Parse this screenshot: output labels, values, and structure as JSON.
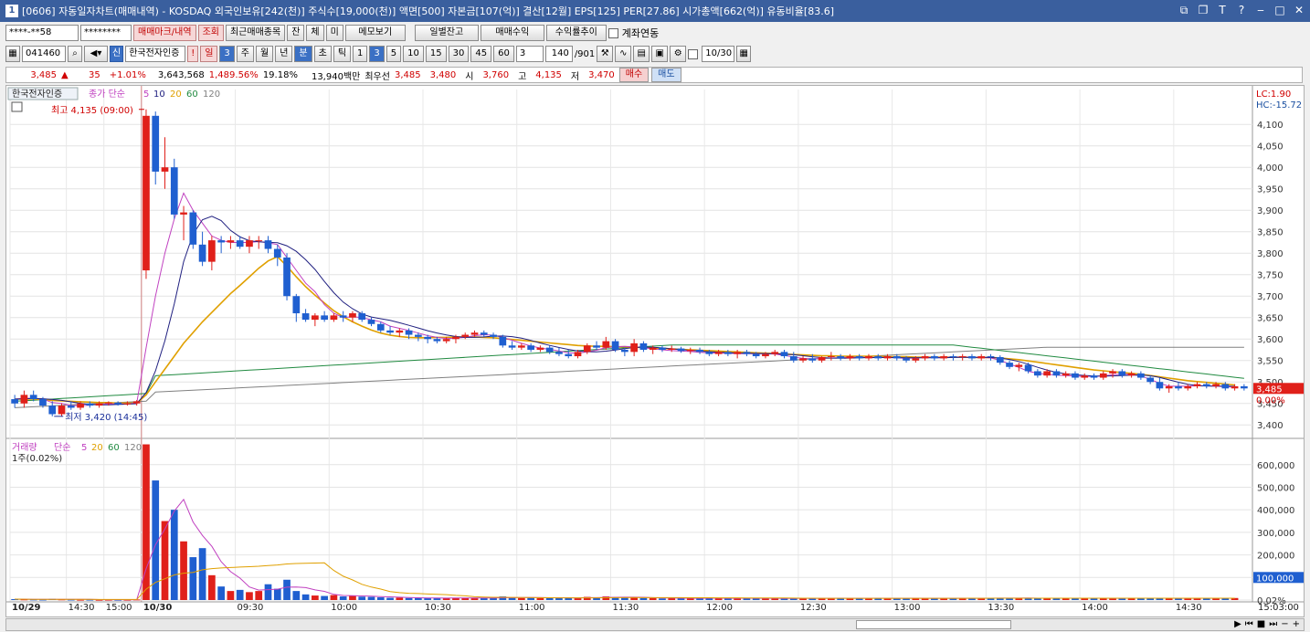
{
  "window": {
    "code_badge": "1",
    "title": "[0606] 자동일자차트(매매내역) - KOSDAQ 외국인보유[242(천)] 주식수[19,000(천)] 액면[500] 자본금[107(억)] 결산[12월] EPS[125] PER[27.86] 시가총액[662(억)] 유동비율[83.6]"
  },
  "toolbar1": {
    "account": "****-**58",
    "password": "********",
    "trade_mark_btn": "매매마크/내역",
    "query_btn": "조회",
    "recent_btn": "최근매매종목",
    "jan_btn": "잔",
    "che_btn": "체",
    "mi_btn": "미",
    "memo_btn": "메모보기",
    "daily_btn": "일별잔고",
    "trade_profit_btn": "매매수익",
    "return_btn": "수익률추이",
    "link_label": "계좌연동"
  },
  "toolbar2": {
    "code": "041460",
    "credit_badge": "신",
    "stock_name": "한국전자인증",
    "alert": "!",
    "day_btn": "일",
    "day_num": "3",
    "week_btn": "주",
    "month_btn": "월",
    "year_btn": "년",
    "minute_btn": "분",
    "second_btn": "초",
    "tick_btn": "틱",
    "intervals": [
      "1",
      "3",
      "5",
      "10",
      "15",
      "30",
      "45",
      "60"
    ],
    "selected_interval": "3",
    "interval_input": "3",
    "count": "140",
    "total": "/901",
    "date": "10/30"
  },
  "pricebar": {
    "price": "3,485",
    "change": "35",
    "pct": "+1.01%",
    "volume": "3,643,568",
    "vol_pct": "1,489.56%",
    "turnover": "19.18%",
    "amount": "13,940백만",
    "bid_label": "최우선",
    "ask": "3,485",
    "bid": "3,480",
    "open_label": "시",
    "open": "3,760",
    "high_label": "고",
    "high": "4,135",
    "low_label": "저",
    "low": "3,470",
    "buy_btn": "매수",
    "sell_btn": "매도"
  },
  "colors": {
    "up": "#e0201a",
    "down": "#1f5fd0",
    "ma5": "#c040c0",
    "ma20": "#e0a000",
    "ma60": "#208a40",
    "ma120": "#808080",
    "ma_small": "#202080"
  },
  "chart_data": [
    {
      "type": "candlestick",
      "legend": {
        "name": "한국전자인증",
        "indicator": "종가 단순",
        "periods": [
          "5",
          "10",
          "20",
          "60",
          "120"
        ]
      },
      "annotations": {
        "high": "최고 4,135 (09:00)",
        "low": "최저 3,420 (14:45)",
        "lc": "LC:1.90",
        "hc": "HC:-15.72",
        "last_price": "3,485",
        "last_pct": "0.00%"
      },
      "ylim": [
        3375,
        4160
      ],
      "yticks": [
        "4,100",
        "4,050",
        "4,000",
        "3,950",
        "3,900",
        "3,850",
        "3,800",
        "3,750",
        "3,700",
        "3,650",
        "3,600",
        "3,550",
        "3,500",
        "3,450",
        "3,400"
      ],
      "xticks": [
        "10/29",
        "14:30",
        "15:00",
        "10/30",
        "09:30",
        "10:00",
        "10:30",
        "11:00",
        "11:30",
        "12:00",
        "12:30",
        "13:00",
        "13:30",
        "14:00",
        "14:30",
        "15:03:00"
      ],
      "candles": [
        [
          3460,
          3470,
          3440,
          3450
        ],
        [
          3450,
          3480,
          3440,
          3470
        ],
        [
          3470,
          3480,
          3455,
          3460
        ],
        [
          3460,
          3465,
          3440,
          3445
        ],
        [
          3445,
          3455,
          3420,
          3425
        ],
        [
          3425,
          3450,
          3420,
          3445
        ],
        [
          3445,
          3455,
          3435,
          3440
        ],
        [
          3440,
          3455,
          3435,
          3450
        ],
        [
          3450,
          3455,
          3440,
          3445
        ],
        [
          3445,
          3455,
          3440,
          3450
        ],
        [
          3450,
          3455,
          3445,
          3452
        ],
        [
          3452,
          3455,
          3445,
          3448
        ],
        [
          3448,
          3455,
          3445,
          3450
        ],
        [
          3450,
          3458,
          3445,
          3455
        ],
        [
          3760,
          4135,
          3740,
          4120
        ],
        [
          4120,
          4130,
          3960,
          3990
        ],
        [
          3990,
          4070,
          3950,
          4000
        ],
        [
          4000,
          4020,
          3880,
          3890
        ],
        [
          3890,
          3910,
          3830,
          3895
        ],
        [
          3895,
          3900,
          3810,
          3820
        ],
        [
          3820,
          3850,
          3770,
          3780
        ],
        [
          3780,
          3840,
          3760,
          3830
        ],
        [
          3830,
          3840,
          3800,
          3825
        ],
        [
          3825,
          3840,
          3810,
          3830
        ],
        [
          3830,
          3840,
          3810,
          3815
        ],
        [
          3815,
          3840,
          3800,
          3830
        ],
        [
          3830,
          3840,
          3810,
          3830
        ],
        [
          3830,
          3840,
          3800,
          3810
        ],
        [
          3810,
          3820,
          3770,
          3790
        ],
        [
          3790,
          3800,
          3690,
          3700
        ],
        [
          3700,
          3705,
          3640,
          3660
        ],
        [
          3660,
          3670,
          3640,
          3645
        ],
        [
          3645,
          3660,
          3630,
          3655
        ],
        [
          3655,
          3665,
          3640,
          3645
        ],
        [
          3645,
          3660,
          3640,
          3655
        ],
        [
          3655,
          3665,
          3640,
          3650
        ],
        [
          3650,
          3665,
          3640,
          3660
        ],
        [
          3660,
          3665,
          3640,
          3645
        ],
        [
          3645,
          3650,
          3630,
          3635
        ],
        [
          3635,
          3640,
          3615,
          3620
        ],
        [
          3620,
          3630,
          3610,
          3615
        ],
        [
          3615,
          3625,
          3605,
          3620
        ],
        [
          3620,
          3625,
          3600,
          3610
        ],
        [
          3610,
          3615,
          3595,
          3605
        ],
        [
          3605,
          3610,
          3590,
          3600
        ],
        [
          3600,
          3605,
          3590,
          3595
        ],
        [
          3595,
          3605,
          3590,
          3600
        ],
        [
          3600,
          3610,
          3590,
          3605
        ],
        [
          3605,
          3615,
          3600,
          3610
        ],
        [
          3610,
          3620,
          3605,
          3615
        ],
        [
          3615,
          3620,
          3605,
          3610
        ],
        [
          3610,
          3615,
          3600,
          3605
        ],
        [
          3605,
          3610,
          3580,
          3585
        ],
        [
          3585,
          3595,
          3575,
          3580
        ],
        [
          3580,
          3590,
          3575,
          3585
        ],
        [
          3585,
          3590,
          3570,
          3575
        ],
        [
          3575,
          3585,
          3570,
          3580
        ],
        [
          3580,
          3585,
          3565,
          3570
        ],
        [
          3570,
          3580,
          3560,
          3565
        ],
        [
          3565,
          3575,
          3555,
          3560
        ],
        [
          3560,
          3575,
          3555,
          3570
        ],
        [
          3570,
          3590,
          3565,
          3585
        ],
        [
          3585,
          3595,
          3575,
          3580
        ],
        [
          3580,
          3605,
          3575,
          3595
        ],
        [
          3595,
          3600,
          3570,
          3575
        ],
        [
          3575,
          3580,
          3560,
          3570
        ],
        [
          3570,
          3600,
          3560,
          3590
        ],
        [
          3590,
          3595,
          3570,
          3575
        ],
        [
          3575,
          3585,
          3565,
          3580
        ],
        [
          3580,
          3585,
          3570,
          3575
        ],
        [
          3575,
          3585,
          3570,
          3578
        ],
        [
          3578,
          3582,
          3568,
          3572
        ],
        [
          3572,
          3580,
          3565,
          3575
        ],
        [
          3575,
          3580,
          3565,
          3570
        ],
        [
          3570,
          3575,
          3560,
          3565
        ],
        [
          3565,
          3575,
          3560,
          3570
        ],
        [
          3570,
          3575,
          3560,
          3565
        ],
        [
          3565,
          3575,
          3555,
          3570
        ],
        [
          3570,
          3575,
          3560,
          3565
        ],
        [
          3565,
          3570,
          3555,
          3560
        ],
        [
          3560,
          3570,
          3555,
          3565
        ],
        [
          3565,
          3575,
          3560,
          3570
        ],
        [
          3570,
          3575,
          3555,
          3560
        ],
        [
          3560,
          3570,
          3545,
          3550
        ],
        [
          3550,
          3560,
          3545,
          3555
        ],
        [
          3555,
          3565,
          3545,
          3550
        ],
        [
          3550,
          3560,
          3545,
          3558
        ],
        [
          3558,
          3570,
          3550,
          3560
        ],
        [
          3560,
          3565,
          3550,
          3555
        ],
        [
          3555,
          3565,
          3550,
          3560
        ],
        [
          3560,
          3565,
          3550,
          3555
        ],
        [
          3555,
          3565,
          3550,
          3560
        ],
        [
          3560,
          3565,
          3550,
          3555
        ],
        [
          3555,
          3565,
          3550,
          3560
        ],
        [
          3560,
          3565,
          3550,
          3555
        ],
        [
          3555,
          3560,
          3545,
          3550
        ],
        [
          3550,
          3560,
          3545,
          3555
        ],
        [
          3555,
          3565,
          3550,
          3560
        ],
        [
          3560,
          3565,
          3550,
          3555
        ],
        [
          3555,
          3565,
          3550,
          3560
        ],
        [
          3560,
          3565,
          3550,
          3558
        ],
        [
          3558,
          3565,
          3550,
          3560
        ],
        [
          3560,
          3565,
          3550,
          3555
        ],
        [
          3555,
          3565,
          3550,
          3560
        ],
        [
          3560,
          3565,
          3550,
          3558
        ],
        [
          3558,
          3562,
          3540,
          3545
        ],
        [
          3545,
          3550,
          3530,
          3535
        ],
        [
          3535,
          3545,
          3525,
          3540
        ],
        [
          3540,
          3545,
          3520,
          3525
        ],
        [
          3525,
          3530,
          3510,
          3515
        ],
        [
          3515,
          3530,
          3510,
          3525
        ],
        [
          3525,
          3530,
          3510,
          3515
        ],
        [
          3515,
          3525,
          3510,
          3520
        ],
        [
          3520,
          3525,
          3505,
          3510
        ],
        [
          3510,
          3520,
          3505,
          3515
        ],
        [
          3515,
          3520,
          3505,
          3510
        ],
        [
          3510,
          3525,
          3505,
          3520
        ],
        [
          3520,
          3530,
          3510,
          3525
        ],
        [
          3525,
          3530,
          3510,
          3515
        ],
        [
          3515,
          3525,
          3510,
          3520
        ],
        [
          3520,
          3525,
          3505,
          3510
        ],
        [
          3510,
          3515,
          3495,
          3500
        ],
        [
          3500,
          3510,
          3480,
          3485
        ],
        [
          3485,
          3495,
          3475,
          3490
        ],
        [
          3490,
          3500,
          3480,
          3485
        ],
        [
          3485,
          3495,
          3480,
          3490
        ],
        [
          3490,
          3500,
          3485,
          3495
        ],
        [
          3495,
          3500,
          3485,
          3490
        ],
        [
          3490,
          3500,
          3485,
          3495
        ],
        [
          3495,
          3500,
          3480,
          3485
        ],
        [
          3485,
          3495,
          3480,
          3490
        ],
        [
          3490,
          3495,
          3480,
          3485
        ]
      ],
      "ma5": [
        3460,
        3462,
        3462,
        3460,
        3452,
        3450,
        3445,
        3445,
        3446,
        3449,
        3449,
        3449,
        3449,
        3451,
        3580,
        3700,
        3800,
        3880,
        3940,
        3900,
        3870,
        3840,
        3830,
        3825,
        3825,
        3825,
        3827,
        3824,
        3820,
        3790,
        3760,
        3730,
        3710,
        3680,
        3660,
        3650,
        3652,
        3650,
        3645,
        3640,
        3630,
        3625,
        3620,
        3614,
        3608,
        3604,
        3601,
        3602,
        3604,
        3608,
        3610,
        3609,
        3604,
        3597,
        3590,
        3584,
        3579,
        3576,
        3572,
        3568,
        3567,
        3570,
        3574,
        3580,
        3582,
        3583,
        3582,
        3580,
        3577,
        3575,
        3573,
        3572,
        3571,
        3569,
        3568,
        3567,
        3567,
        3566,
        3566,
        3566,
        3566,
        3565,
        3562,
        3558,
        3555,
        3554,
        3555,
        3556,
        3556,
        3557,
        3557,
        3557,
        3557,
        3557,
        3556,
        3555,
        3556,
        3557,
        3557,
        3557,
        3558,
        3558,
        3557,
        3557,
        3556,
        3550,
        3542,
        3534,
        3525,
        3520,
        3518,
        3516,
        3515,
        3514,
        3513,
        3513,
        3514,
        3517,
        3518,
        3518,
        3514,
        3506,
        3497,
        3490,
        3490,
        3490,
        3491,
        3491,
        3490,
        3489,
        3488
      ],
      "ma20": [
        3460,
        3460,
        3460,
        3459,
        3457,
        3456,
        3455,
        3454,
        3453,
        3452,
        3452,
        3451,
        3451,
        3451,
        3470,
        3500,
        3530,
        3560,
        3590,
        3615,
        3640,
        3662,
        3684,
        3706,
        3725,
        3745,
        3765,
        3782,
        3792,
        3770,
        3745,
        3722,
        3702,
        3684,
        3666,
        3652,
        3640,
        3630,
        3621,
        3614,
        3609,
        3606,
        3604,
        3603,
        3603,
        3604,
        3604,
        3605,
        3605,
        3605,
        3604,
        3603,
        3601,
        3599,
        3597,
        3595,
        3593,
        3591,
        3589,
        3587,
        3585,
        3584,
        3583,
        3583,
        3582,
        3582,
        3581,
        3580,
        3579,
        3578,
        3577,
        3576,
        3575,
        3574,
        3573,
        3572,
        3571,
        3570,
        3569,
        3568,
        3567,
        3566,
        3565,
        3564,
        3563,
        3562,
        3561,
        3561,
        3560,
        3560,
        3560,
        3560,
        3560,
        3559,
        3559,
        3559,
        3558,
        3558,
        3558,
        3558,
        3558,
        3558,
        3557,
        3557,
        3557,
        3556,
        3554,
        3552,
        3549,
        3546,
        3543,
        3540,
        3537,
        3534,
        3531,
        3528,
        3526,
        3524,
        3522,
        3520,
        3518,
        3515,
        3512,
        3509,
        3506,
        3503,
        3501,
        3499,
        3497,
        3495,
        3493
      ]
    },
    {
      "type": "bar",
      "legend": {
        "name": "거래량",
        "indicator": "단순",
        "periods": [
          "5",
          "20",
          "60",
          "120"
        ],
        "unit_note": "1주(0.02%)"
      },
      "ylim": [
        0,
        680000
      ],
      "yticks": [
        "600,000",
        "500,000",
        "400,000",
        "300,000",
        "200,000",
        "100,000",
        "0.02%"
      ],
      "last_value_label": "100,000",
      "values": [
        4000,
        3000,
        2500,
        2000,
        5000,
        3000,
        2000,
        1500,
        1800,
        1200,
        1500,
        1300,
        1400,
        2500,
        690000,
        530000,
        350000,
        400000,
        260000,
        190000,
        230000,
        110000,
        60000,
        40000,
        45000,
        35000,
        40000,
        70000,
        50000,
        90000,
        40000,
        25000,
        20000,
        18000,
        22000,
        16000,
        20000,
        15000,
        14000,
        12000,
        10000,
        11000,
        9000,
        9000,
        8000,
        8000,
        9000,
        10000,
        9000,
        8000,
        9000,
        8000,
        16000,
        12000,
        9000,
        12000,
        8000,
        10000,
        11000,
        9000,
        8000,
        14000,
        11000,
        16000,
        12000,
        10000,
        13000,
        9000,
        8000,
        7000,
        9000,
        8000,
        8000,
        7000,
        9000,
        8000,
        7000,
        8000,
        9000,
        7000,
        8000,
        7000,
        6000,
        8000,
        9000,
        7000,
        8000,
        7000,
        9000,
        8000,
        7000,
        8000,
        9000,
        7000,
        8000,
        7000,
        9000,
        8000,
        7000,
        8000,
        7000,
        9000,
        8000,
        7000,
        10000,
        9000,
        8000,
        9000,
        8000,
        7000,
        9000,
        8000,
        9000,
        8000,
        7000,
        8000,
        9000,
        7000,
        8000,
        9000,
        8000,
        9000,
        7000,
        8000,
        7000,
        8000,
        9000,
        8000,
        7000,
        8000,
        9000
      ]
    }
  ]
}
